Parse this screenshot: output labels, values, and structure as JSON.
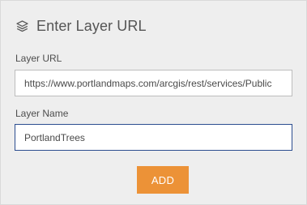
{
  "header": {
    "icon": "layers-icon",
    "title": "Enter Layer URL"
  },
  "form": {
    "url_label": "Layer URL",
    "url_value": "https://www.portlandmaps.com/arcgis/rest/services/Public",
    "name_label": "Layer Name",
    "name_value": "PortlandTrees"
  },
  "actions": {
    "add_label": "ADD"
  },
  "colors": {
    "panel_background": "#eeeeee",
    "accent_button": "#ec9237",
    "focused_border": "#2b4d8f"
  }
}
